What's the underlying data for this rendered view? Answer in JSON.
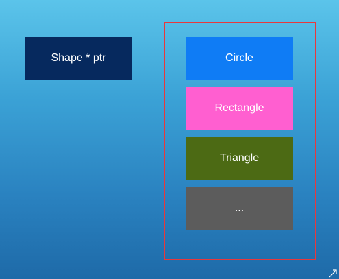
{
  "pointer": {
    "label": "Shape * ptr",
    "color": "#06295e"
  },
  "container": {
    "border_color": "#e8383c",
    "items": [
      {
        "label": "Circle",
        "color": "#0f7cf5"
      },
      {
        "label": "Rectangle",
        "color": "#ff5fd0"
      },
      {
        "label": "Triangle",
        "color": "#4c6a14"
      },
      {
        "label": "...",
        "color": "#5c5c5c"
      }
    ]
  },
  "corner_icon": "arrow-icon"
}
